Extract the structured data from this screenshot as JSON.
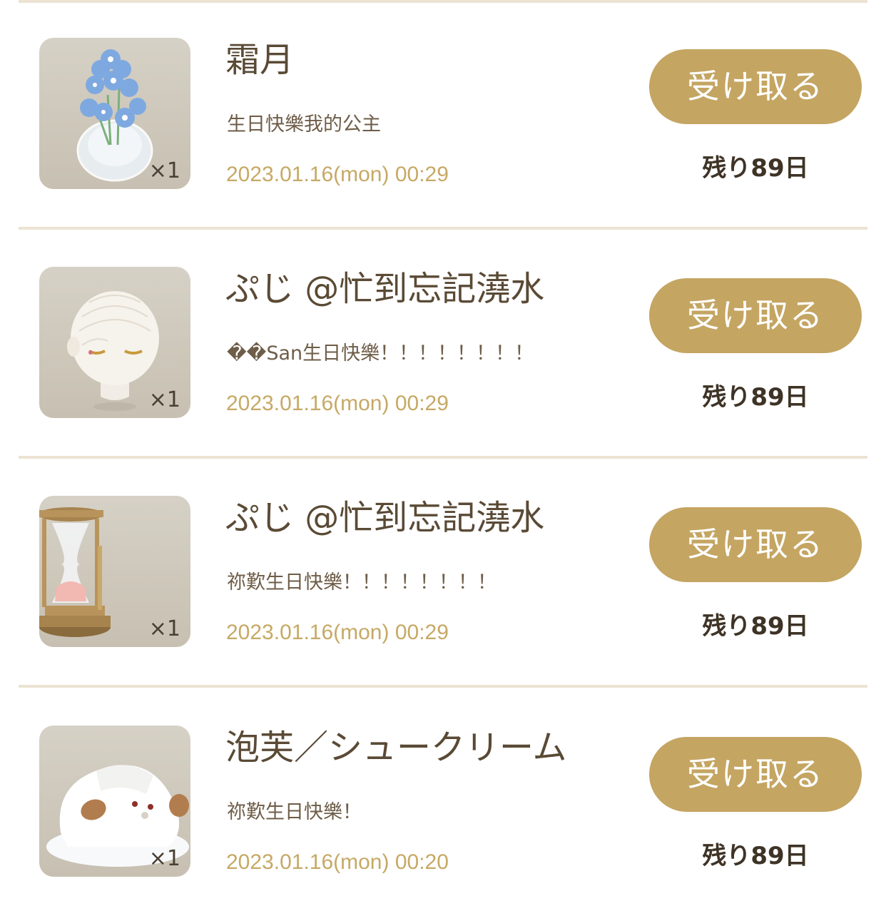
{
  "gifts": [
    {
      "item_icon": "blue-flowers-in-vase-icon",
      "quantity": "×1",
      "sender": "霜月",
      "message": "生日快樂我的公主",
      "date": "2023.01.16(mon) 00:29",
      "button_label": "受け取る",
      "remaining": "残り89日"
    },
    {
      "item_icon": "braided-hair-head-icon",
      "quantity": "×1",
      "sender": "ぷじ @忙到忘記澆水",
      "message": "��San生日快樂！！！！！！！！",
      "date": "2023.01.16(mon) 00:29",
      "button_label": "受け取る",
      "remaining": "残り89日"
    },
    {
      "item_icon": "hourglass-icon",
      "quantity": "×1",
      "sender": "ぷじ @忙到忘記澆水",
      "message": "祢歎生日快樂！！！！！！！！",
      "date": "2023.01.16(mon) 00:29",
      "button_label": "受け取る",
      "remaining": "残り89日"
    },
    {
      "item_icon": "white-fluffy-dog-icon",
      "quantity": "×1",
      "sender": "泡芙／シュークリーム",
      "message": "祢歎生日快樂！",
      "date": "2023.01.16(mon) 00:20",
      "button_label": "受け取る",
      "remaining": "残り89日"
    }
  ],
  "colors": {
    "button": "#c4a562",
    "date_text": "#c6a965",
    "divider": "#ece3d3"
  }
}
